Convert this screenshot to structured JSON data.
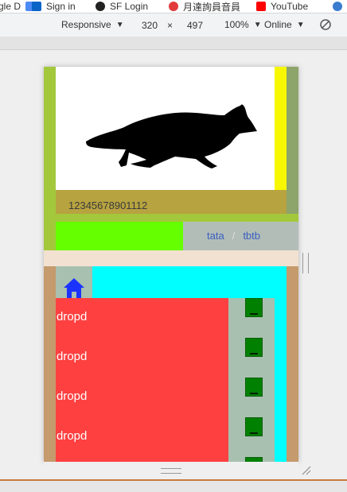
{
  "bookmarks": [
    {
      "label": "gle D",
      "icon": "blue-doc-icon"
    },
    {
      "label": "Sign in",
      "icon": "outlook-icon"
    },
    {
      "label": "SF Login",
      "icon": "sf-logo-icon"
    },
    {
      "label": "月達詢員音員",
      "icon": "red-bird-icon"
    },
    {
      "label": "YouTube",
      "icon": "youtube-icon"
    },
    {
      "label": "",
      "icon": "extension-icon"
    }
  ],
  "device_toolbar": {
    "device_label": "Responsive",
    "width_value": "320",
    "separator": "×",
    "height_value": "497",
    "zoom_label": "100%",
    "network_label": "Online"
  },
  "page": {
    "hero_number": "12345678901112",
    "breadcrumb": [
      "tata",
      "/",
      "tbtb"
    ],
    "dropdown_items": [
      "dropd",
      "dropd",
      "dropd",
      "dropd"
    ]
  },
  "colors": {
    "lime": "#66ff00",
    "cyan": "#00ffff",
    "red": "#ff4040",
    "green": "#008000",
    "yellow": "#f7f700",
    "olive": "#b7a340"
  }
}
